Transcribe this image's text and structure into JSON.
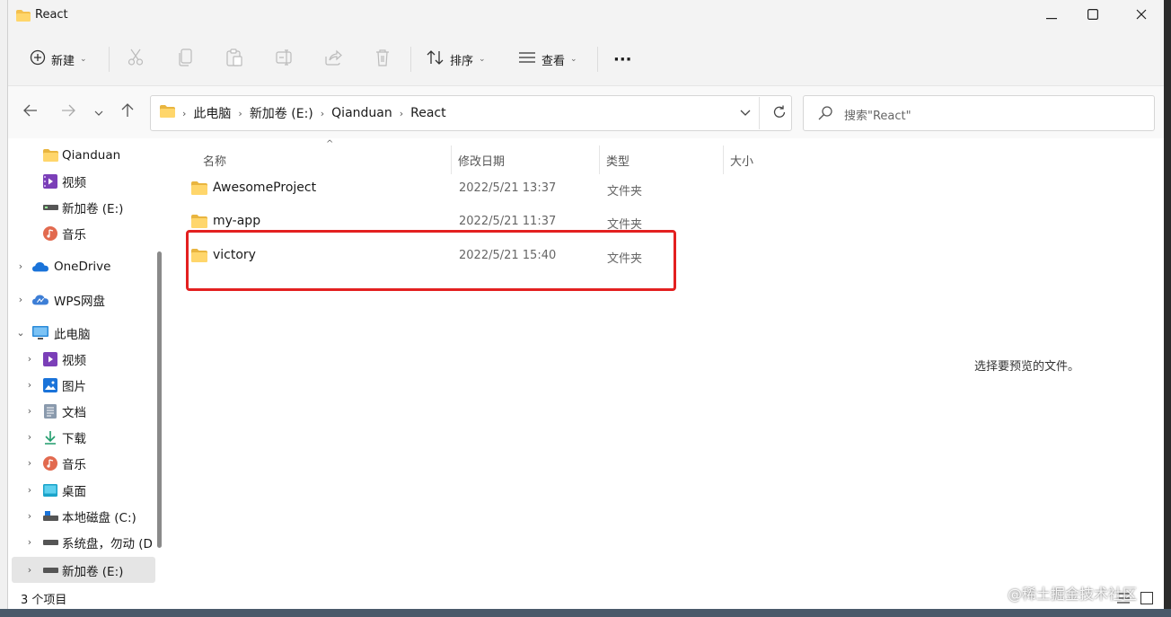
{
  "window": {
    "title": "React",
    "minimize_icon": "minimize-icon",
    "maximize_icon": "maximize-icon",
    "close_icon": "close-icon"
  },
  "toolbar": {
    "new_label": "新建",
    "sort_label": "排序",
    "view_label": "查看",
    "more_label": "···"
  },
  "address": {
    "crumbs": [
      "此电脑",
      "新加卷 (E:)",
      "Qianduan",
      "React"
    ]
  },
  "search": {
    "placeholder": "搜索\"React\""
  },
  "sidebar": {
    "items": [
      {
        "label": "Qianduan",
        "icon": "folder-icon"
      },
      {
        "label": "视频",
        "icon": "video-icon"
      },
      {
        "label": "新加卷 (E:)",
        "icon": "drive-icon"
      },
      {
        "label": "音乐",
        "icon": "music-icon"
      },
      {
        "label": "OneDrive",
        "icon": "onedrive-icon"
      },
      {
        "label": "WPS网盘",
        "icon": "cloud-icon"
      },
      {
        "label": "此电脑",
        "icon": "computer-icon"
      },
      {
        "label": "视频",
        "icon": "video-icon"
      },
      {
        "label": "图片",
        "icon": "pictures-icon"
      },
      {
        "label": "文档",
        "icon": "documents-icon"
      },
      {
        "label": "下载",
        "icon": "download-icon"
      },
      {
        "label": "音乐",
        "icon": "music-icon"
      },
      {
        "label": "桌面",
        "icon": "desktop-icon"
      },
      {
        "label": "本地磁盘 (C:)",
        "icon": "drive-icon"
      },
      {
        "label": "系统盘，勿动 (D",
        "icon": "drive-icon"
      },
      {
        "label": "新加卷 (E:)",
        "icon": "drive-icon"
      }
    ]
  },
  "columns": {
    "name": "名称",
    "modified": "修改日期",
    "type": "类型",
    "size": "大小"
  },
  "files": [
    {
      "name": "AwesomeProject",
      "modified": "2022/5/21 13:37",
      "type": "文件夹"
    },
    {
      "name": "my-app",
      "modified": "2022/5/21 11:37",
      "type": "文件夹"
    },
    {
      "name": "victory",
      "modified": "2022/5/21 15:40",
      "type": "文件夹"
    }
  ],
  "preview": {
    "text": "选择要预览的文件。"
  },
  "status": {
    "count": "3 个项目"
  },
  "watermark": "@稀土掘金技术社区",
  "colors": {
    "highlight": "#e32020",
    "folder": "#f4c04e",
    "selected": "#e5e5e5"
  }
}
